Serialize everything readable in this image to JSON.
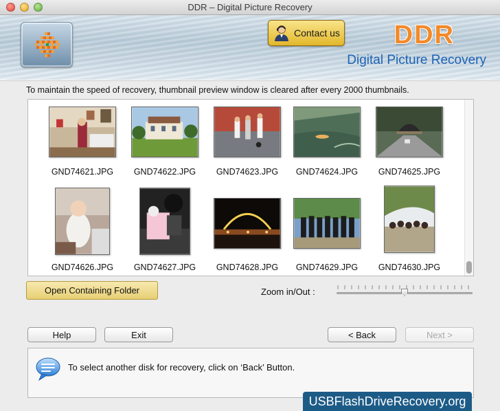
{
  "window": {
    "title": "DDR – Digital Picture Recovery"
  },
  "header": {
    "contact_label": "Contact us",
    "brand_title": "DDR",
    "brand_subtitle": "Digital Picture Recovery"
  },
  "info_text": "To maintain the speed of recovery, thumbnail preview window is cleared after every 2000 thumbnails.",
  "thumbnails": [
    {
      "name": "GND74621.JPG"
    },
    {
      "name": "GND74622.JPG"
    },
    {
      "name": "GND74623.JPG"
    },
    {
      "name": "GND74624.JPG"
    },
    {
      "name": "GND74625.JPG"
    },
    {
      "name": "GND74626.JPG"
    },
    {
      "name": "GND74627.JPG"
    },
    {
      "name": "GND74628.JPG"
    },
    {
      "name": "GND74629.JPG"
    },
    {
      "name": "GND74630.JPG"
    }
  ],
  "open_folder_label": "Open Containing Folder",
  "zoom": {
    "label": "Zoom in/Out :",
    "value_fraction": 0.5
  },
  "buttons": {
    "help": "Help",
    "exit": "Exit",
    "back": "< Back",
    "next": "Next >"
  },
  "message": "To select another disk for recovery, click on ‘Back’ Button.",
  "watermark": "USBFlashDriveRecovery.org",
  "colors": {
    "accent_orange": "#f28a2a",
    "subtitle_blue": "#1d63b5",
    "button_gold": "#e2b72b",
    "watermark_bg": "#1d5b87"
  }
}
